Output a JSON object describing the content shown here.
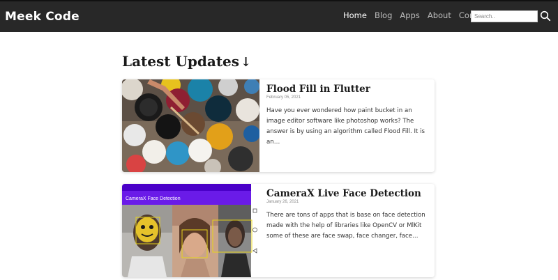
{
  "navbar": {
    "brand": "Meek Code",
    "links": [
      "Home",
      "Blog",
      "Apps",
      "About",
      "Contact"
    ],
    "active_link": "Home",
    "search_placeholder": "Search.."
  },
  "main": {
    "section_title": "Latest Updates",
    "posts": [
      {
        "title": "Flood Fill in Flutter",
        "date": "February 05, 2021",
        "excerpt": "Have you ever wondered how paint bucket in an image editor software like photoshop works? The answer is by using an algorithm called Flood Fill. It is an…",
        "image_alt": "paint buckets"
      },
      {
        "title": "CameraX Live Face Detection",
        "date": "January 26, 2021",
        "excerpt": "There are tons of apps that is base on face detection made with the help of libraries like OpenCV or MlKit some of these are face swap, face changer, face…",
        "image_alt": "CameraX Face Detection screenshot",
        "image_app_title": "CameraX Face Detection"
      }
    ]
  },
  "colors": {
    "navbar_bg": "#282828",
    "accent": "#6200ee"
  }
}
